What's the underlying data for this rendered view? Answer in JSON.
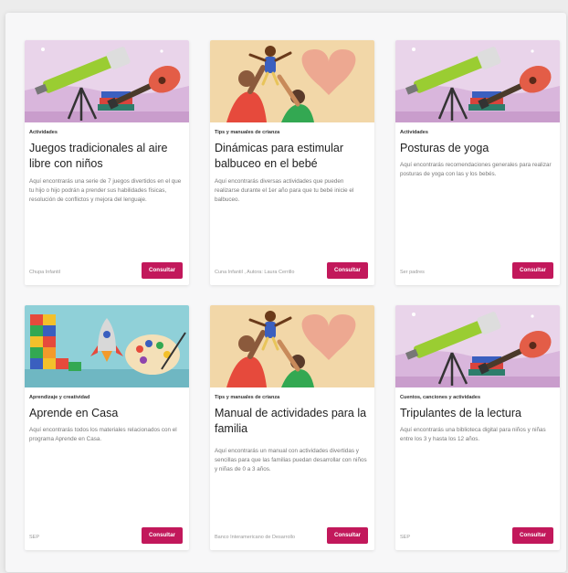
{
  "cards": [
    {
      "image": "telescope-guitar-illustration",
      "category": "Actividades",
      "title": "Juegos tradicionales al aire libre con niños",
      "description": "Aquí encontrarás una serie de 7 juegos divertidos en el que tu hijo o hijo podrán a prender sus habilidades físicas, resolución de conflictos y mejora del lenguaje.",
      "source": "Chupa Infantil",
      "button": "Consultar"
    },
    {
      "image": "parents-lifting-child-illustration",
      "category": "Tips y manuales de crianza",
      "title": "Dinámicas para estimular balbuceo en el bebé",
      "description": "Aquí encontrarás diversas actividades que pueden realizarse durante el 1er año para que tu bebé inicie el balbuceo.",
      "source": "Cuna Infantil , Autora: Laura Cerrillo",
      "button": "Consultar"
    },
    {
      "image": "telescope-guitar-illustration",
      "category": "Actividades",
      "title": "Posturas de yoga",
      "description": "Aquí encontrarás recomendaciones generales para realizar posturas de yoga con las y los bebés.",
      "source": "Ser padres",
      "button": "Consultar"
    },
    {
      "image": "blocks-rocket-palette-illustration",
      "category": "Aprendizaje y creatividad",
      "title": "Aprende en Casa",
      "description": "Aquí encontrarás todos los materiales relacionados con el programa Aprende en Casa.",
      "source": "SEP",
      "button": "Consultar"
    },
    {
      "image": "parents-lifting-child-illustration",
      "category": "Tips y manuales de crianza",
      "title": "Manual de actividades para la familia",
      "description": "Aquí encontrarás un manual con actividades divertidas y sencillas para que las familias puedan desarrollar con niños y niñas de 0 a 3 años.",
      "source": "Banco Interamericano de Desarrollo",
      "button": "Consultar"
    },
    {
      "image": "telescope-guitar-illustration",
      "category": "Cuentos, canciones y actividades",
      "title": "Tripulantes de la lectura",
      "description": "Aquí encontrarás una biblioteca digital para niños y niñas entre los 3 y hasta los 12 años.",
      "source": "SEP",
      "button": "Consultar"
    }
  ]
}
